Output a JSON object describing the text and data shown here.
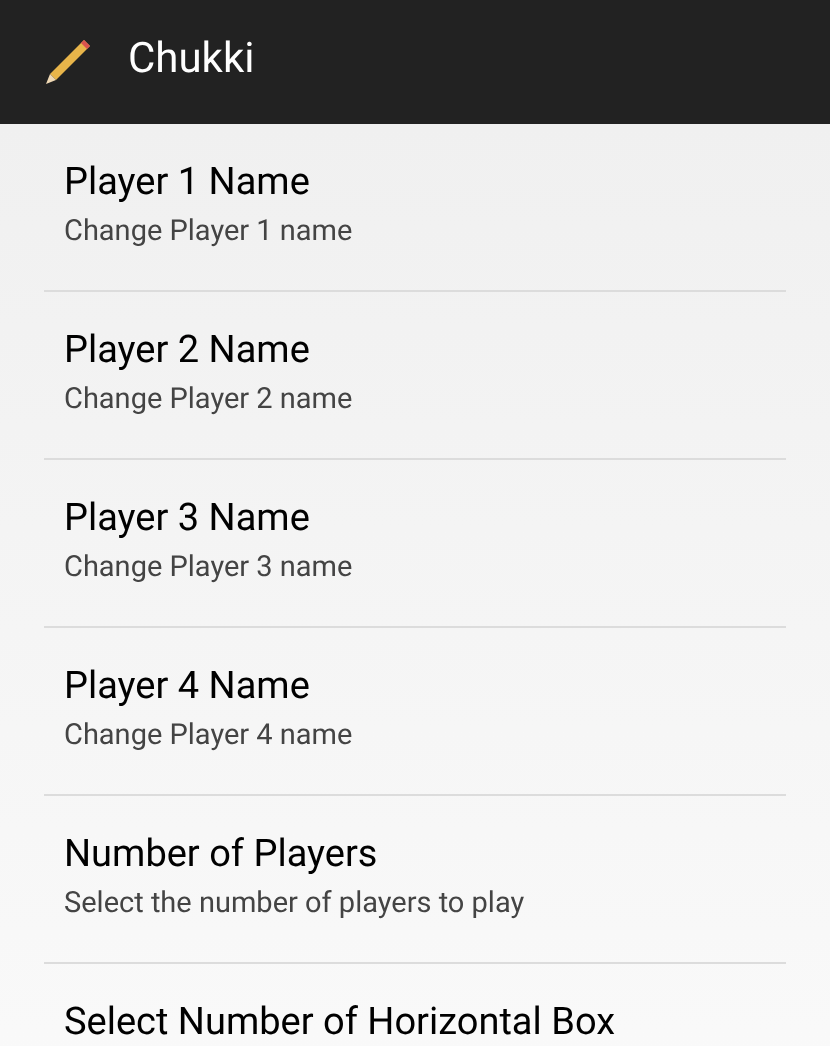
{
  "action_bar": {
    "title": "Chukki"
  },
  "preferences": [
    {
      "title": "Player 1 Name",
      "summary": "Change Player 1 name"
    },
    {
      "title": "Player 2 Name",
      "summary": "Change Player 2 name"
    },
    {
      "title": "Player 3 Name",
      "summary": "Change Player 3 name"
    },
    {
      "title": "Player 4 Name",
      "summary": "Change Player 4 name"
    },
    {
      "title": "Number of Players",
      "summary": "Select the number of players to play"
    },
    {
      "title": "Select Number of Horizontal Box"
    }
  ]
}
